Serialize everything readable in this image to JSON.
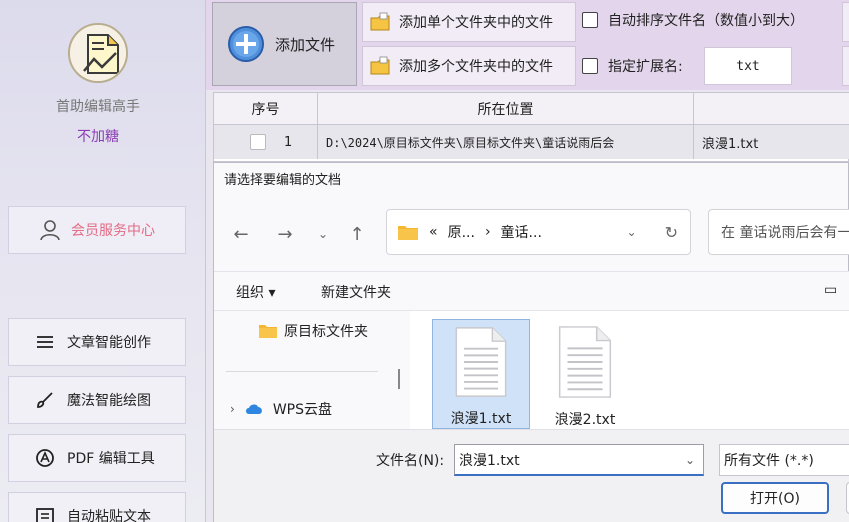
{
  "sidebar": {
    "app_name": "首助编辑高手",
    "app_subtitle": "不加糖",
    "member_center": "会员服务中心",
    "nav": [
      {
        "label": "文章智能创作",
        "icon": "list-icon"
      },
      {
        "label": "魔法智能绘图",
        "icon": "brush-icon"
      },
      {
        "label": "PDF 编辑工具",
        "icon": "pdf-icon"
      },
      {
        "label": "自动粘贴文本",
        "icon": "paste-icon"
      }
    ]
  },
  "toolbar": {
    "add_file": "添加文件",
    "add_single_folder": "添加单个文件夹中的文件",
    "add_multi_folder": "添加多个文件夹中的文件",
    "auto_sort": "自动排序文件名（数值小到大）",
    "specify_ext": "指定扩展名:",
    "ext_value": "txt"
  },
  "table": {
    "headers": [
      "序号",
      "所在位置",
      ""
    ],
    "rows": [
      {
        "index": "1",
        "path": "D:\\2024\\原目标文件夹\\原目标文件夹\\童话说雨后会",
        "name": "浪漫1.txt"
      }
    ]
  },
  "dialog": {
    "title": "请选择要编辑的文档",
    "address_prefix": "«",
    "address_seg1": "原...",
    "address_sep": "›",
    "address_seg2": "童话...",
    "search_placeholder": "在 童话说雨后会有一",
    "organize": "组织 ▾",
    "new_folder": "新建文件夹",
    "nav_items": [
      "原目标文件夹",
      "WPS云盘"
    ],
    "files": [
      "浪漫1.txt",
      "浪漫2.txt"
    ],
    "filename_label": "文件名(N):",
    "filename_value": "浪漫1.txt",
    "filetype_value": "所有文件 (*.*)",
    "open_button": "打开(O)"
  },
  "colors": {
    "accent": "#3b6fc4",
    "member_text": "#e36c86",
    "subtitle": "#8a3db5",
    "folder": "#f5b731"
  }
}
